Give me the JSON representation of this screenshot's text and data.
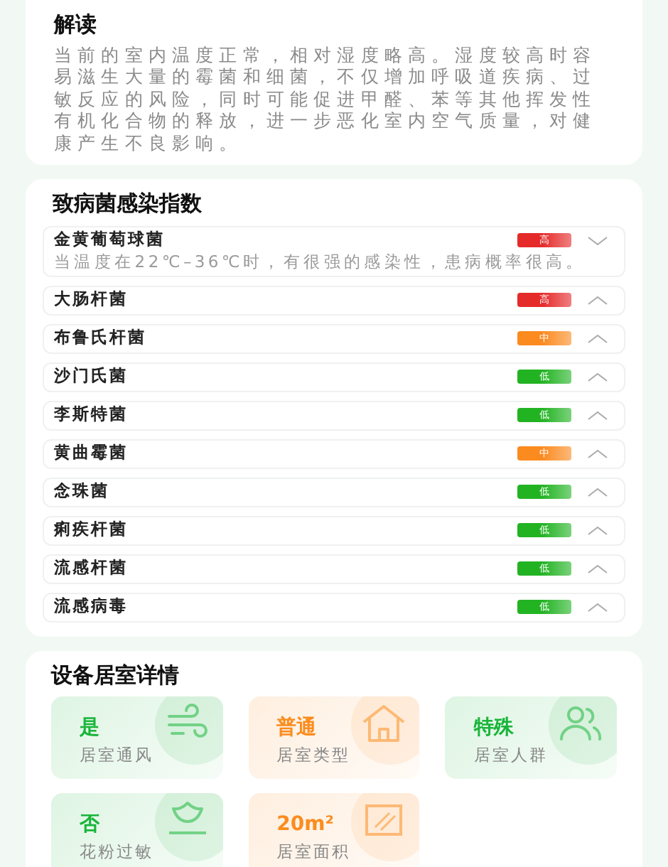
{
  "interpretation": {
    "title": "解读",
    "text": "当前的室内温度正常，相对湿度略高。湿度较高时容易滋生大量的霉菌和细菌，不仅增加呼吸道疾病、过敏反应的风险，同时可能促进甲醛、苯等其他挥发性有机化合物的释放，进一步恶化室内空气质量，对健康产生不良影响。"
  },
  "pathogens": {
    "title": "致病菌感染指数",
    "items": [
      {
        "name": "金黄葡萄球菌",
        "color": "#e52a2a",
        "badge": "高",
        "expanded": true,
        "description": "当温度在22℃–36℃时，有很强的感染性，患病概率很高。"
      },
      {
        "name": "大肠杆菌",
        "color": "#e52a2a",
        "badge": "高",
        "expanded": false
      },
      {
        "name": "布鲁氏杆菌",
        "color": "#fb8a1f",
        "badge": "中",
        "expanded": false
      },
      {
        "name": "沙门氏菌",
        "color": "#22b322",
        "badge": "低",
        "expanded": false
      },
      {
        "name": "李斯特菌",
        "color": "#22b322",
        "badge": "低",
        "expanded": false
      },
      {
        "name": "黄曲霉菌",
        "color": "#fb8a1f",
        "badge": "中",
        "expanded": false
      },
      {
        "name": "念珠菌",
        "color": "#22b322",
        "badge": "低",
        "expanded": false
      },
      {
        "name": "痢疾杆菌",
        "color": "#22b322",
        "badge": "低",
        "expanded": false
      },
      {
        "name": "流感杆菌",
        "color": "#22b322",
        "badge": "低",
        "expanded": false
      },
      {
        "name": "流感病毒",
        "color": "#22b322",
        "badge": "低",
        "expanded": false
      }
    ]
  },
  "room_details": {
    "title": "设备居室详情",
    "items": [
      {
        "value": "是",
        "label": "居室通风",
        "color": "#19b53a",
        "kind": "wind"
      },
      {
        "value": "普通",
        "label": "居室类型",
        "color": "#fb8c1e",
        "kind": "house"
      },
      {
        "value": "特殊",
        "label": "居室人群",
        "color": "#19b53a",
        "kind": "people"
      },
      {
        "value": "否",
        "label": "花粉过敏",
        "color": "#19b53a",
        "kind": "flower"
      },
      {
        "value": "20m²",
        "label": "居室面积",
        "color": "#fb8c1e",
        "kind": "area"
      }
    ]
  }
}
